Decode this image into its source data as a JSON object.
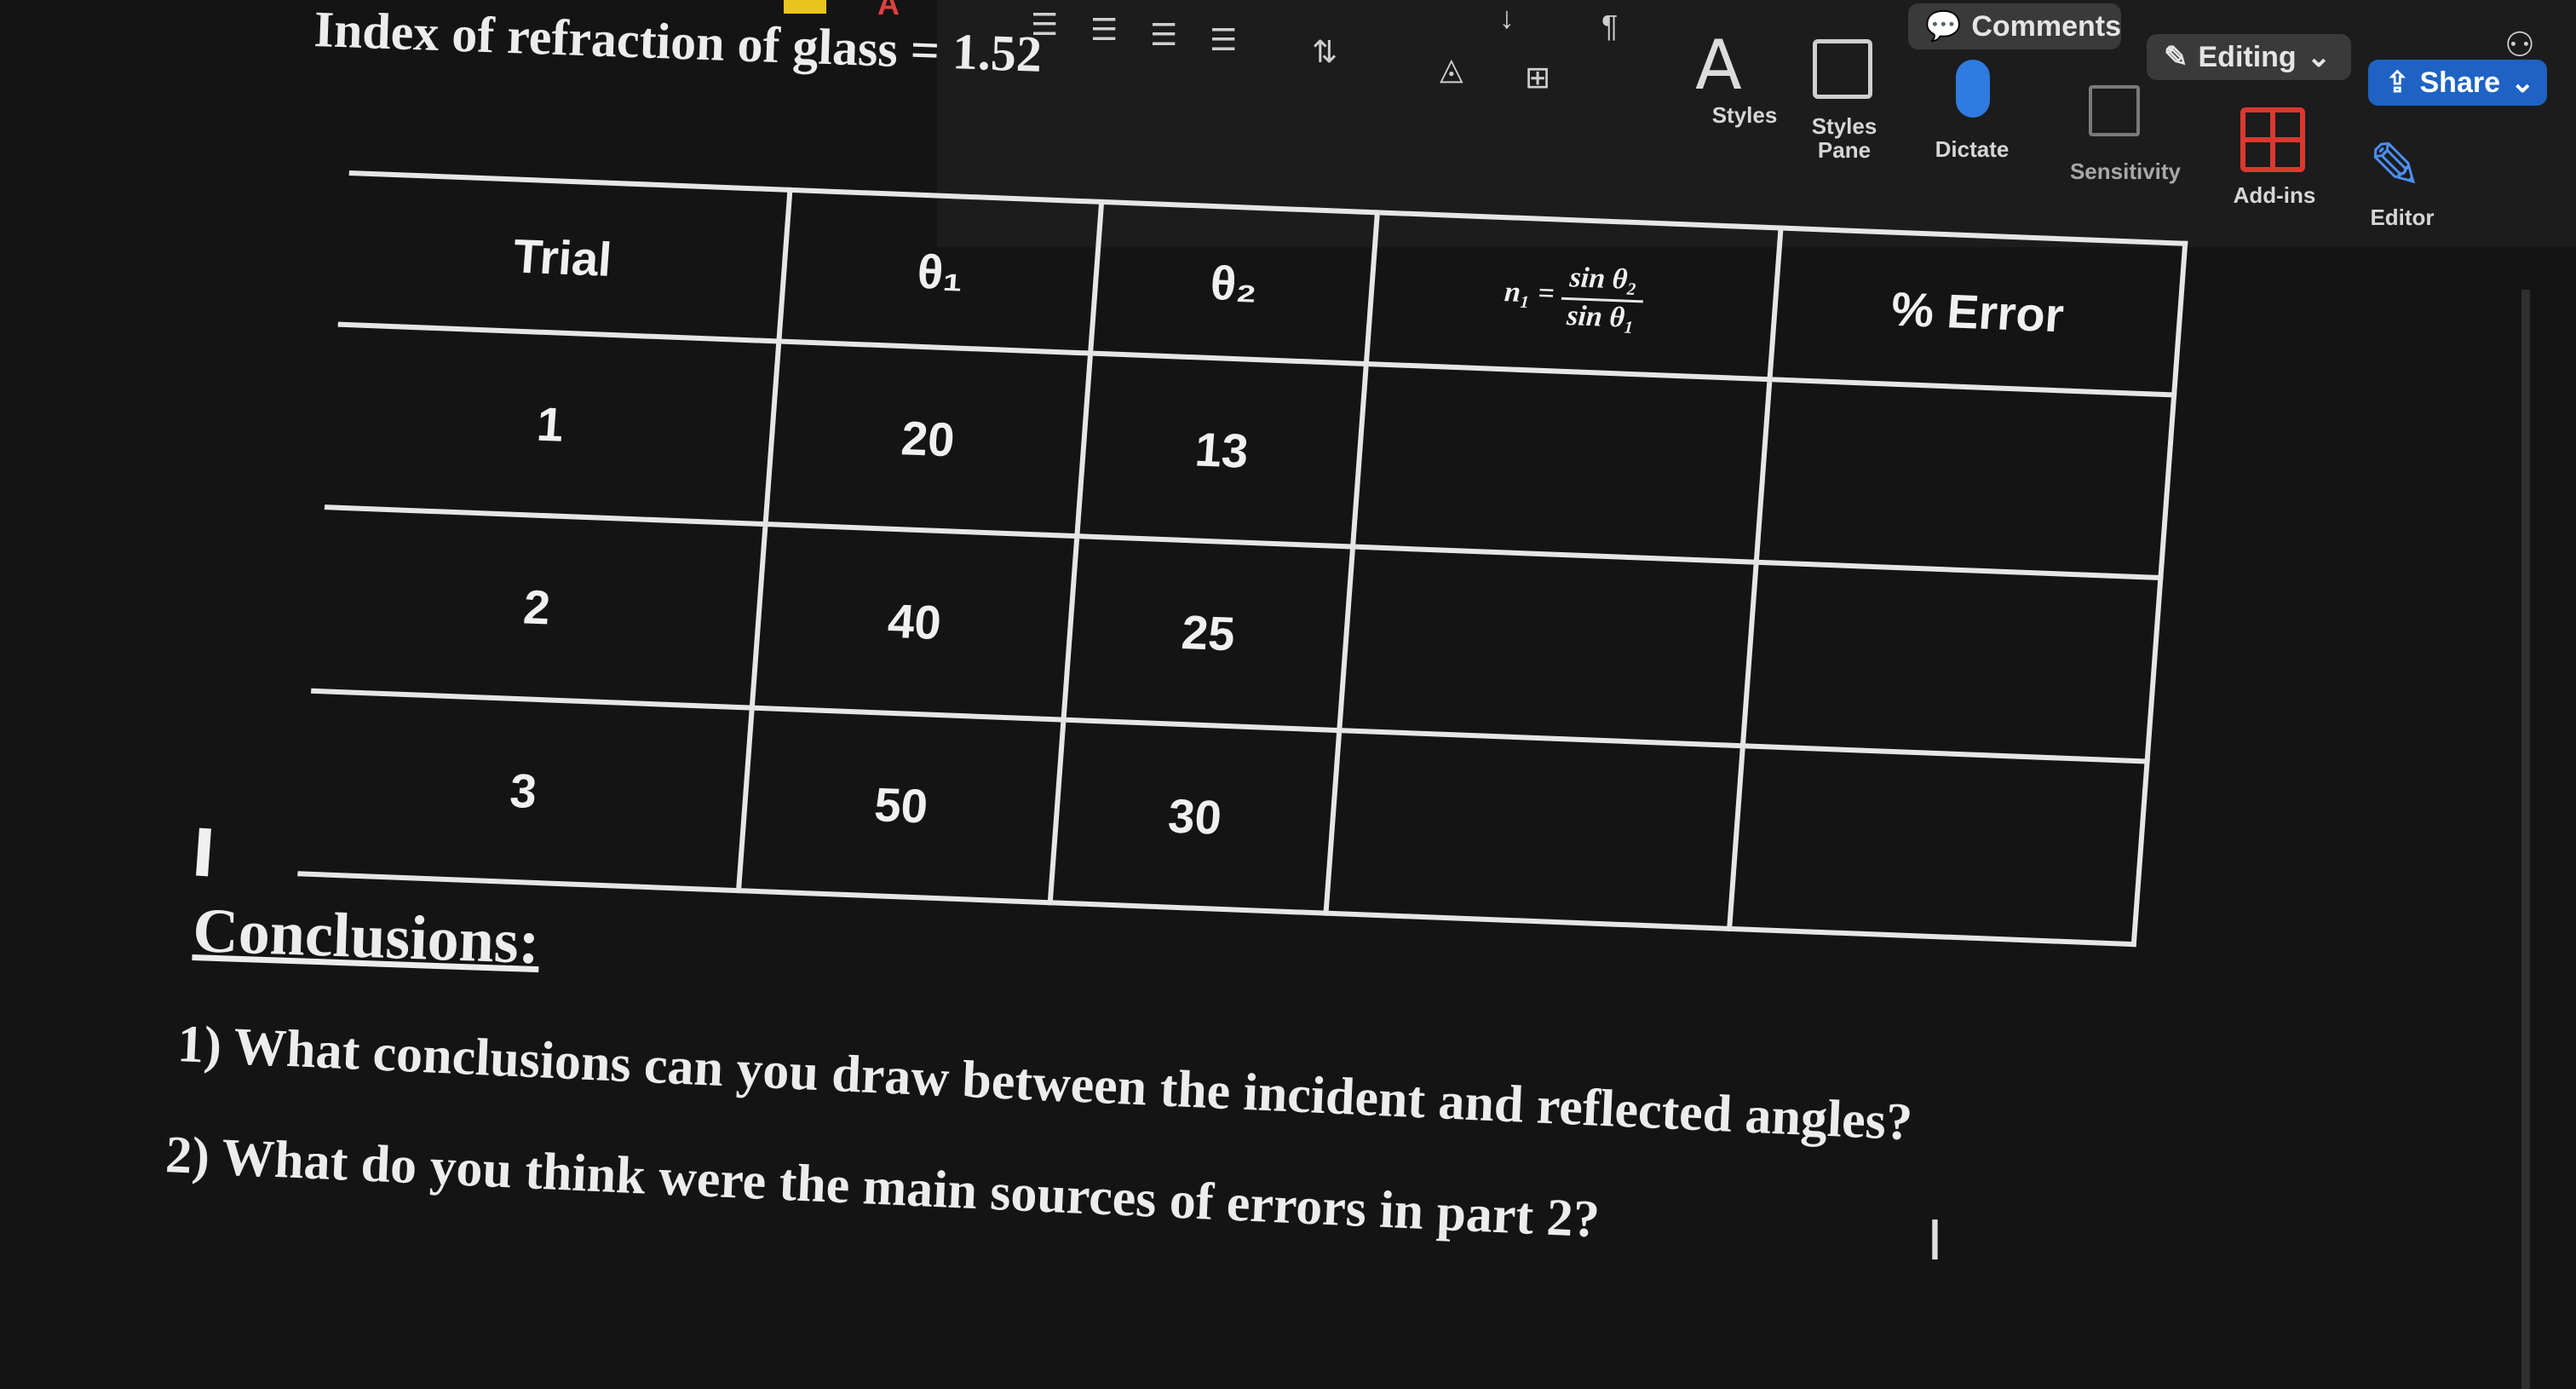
{
  "ribbon": {
    "styles_label": "Styles",
    "styles_pane_label": "Styles Pane",
    "dictate_label": "Dictate",
    "sensitivity_label": "Sensitivity",
    "addins_label": "Add-ins",
    "editor_label": "Editor",
    "comments_label": "Comments",
    "editing_label": "Editing",
    "share_label": "Share",
    "sort_glyph": "↓",
    "pilcrow_glyph": "¶",
    "share_color": "#1e63c4",
    "addins_color": "#d9392f"
  },
  "document": {
    "title": "Index of refraction of glass = 1.52",
    "table": {
      "headers": {
        "trial": "Trial",
        "theta1": "θ₁",
        "theta2": "θ₂",
        "ratio_lhs": "n₁ =",
        "ratio_num": "sin θ₂",
        "ratio_den": "sin θ₁",
        "error": "% Error"
      },
      "rows": [
        {
          "trial": "1",
          "theta1": "20",
          "theta2": "13",
          "ratio": "",
          "error": ""
        },
        {
          "trial": "2",
          "theta1": "40",
          "theta2": "25",
          "ratio": "",
          "error": ""
        },
        {
          "trial": "3",
          "theta1": "50",
          "theta2": "30",
          "ratio": "",
          "error": ""
        }
      ]
    },
    "conclusions_heading": "Conclusions:",
    "questions": [
      "1) What conclusions can you draw between the incident and reflected angles?",
      "2) What do you think were the main sources of errors in part 2?"
    ],
    "ibeam_glyph": "I"
  }
}
